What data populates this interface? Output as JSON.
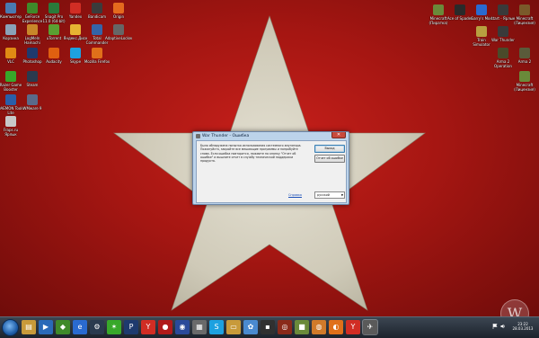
{
  "desktop_icons_left_row": [
    {
      "label": "Компьютер",
      "icon": "computer-icon",
      "color": "#4a7ab0"
    },
    {
      "label": "GeForce Experience",
      "icon": "nvidia-icon",
      "color": "#3f8a2a"
    },
    {
      "label": "Snagit Pro 11.0 (64-bit)",
      "icon": "snagit-icon",
      "color": "#2a7a3a"
    },
    {
      "label": "Yandex",
      "icon": "yandex-icon",
      "color": "#d12d24"
    },
    {
      "label": "Bandicam",
      "icon": "bandicam-icon",
      "color": "#3b3b3b"
    },
    {
      "label": "Origin",
      "icon": "origin-icon",
      "color": "#e46a1e"
    }
  ],
  "desktop_icons_left_row2": [
    {
      "label": "Корзина",
      "icon": "recycle-bin-icon",
      "color": "#8aa2b8"
    },
    {
      "label": "LogMeIn Hamachi",
      "icon": "hamachi-icon",
      "color": "#c8872a"
    },
    {
      "label": "uTorrent",
      "icon": "utorrent-icon",
      "color": "#5aa032"
    },
    {
      "label": "Яндекс.Диск",
      "icon": "yandex-disk-icon",
      "color": "#e6b332"
    },
    {
      "label": "Total Commander",
      "icon": "total-commander-icon",
      "color": "#3464a8"
    },
    {
      "label": "AdaptiveLocker",
      "icon": "locker-icon",
      "color": "#666666"
    }
  ],
  "desktop_icons_left_row3": [
    {
      "label": "Photoshop",
      "icon": "photoshop-icon",
      "color": "#1e3a6e"
    },
    {
      "label": "Audacity",
      "icon": "audacity-icon",
      "color": "#e06010"
    },
    {
      "label": "Skype",
      "icon": "skype-icon",
      "color": "#1da1e0"
    },
    {
      "label": "Mozilla Firefox",
      "icon": "firefox-icon",
      "color": "#e0701a"
    }
  ],
  "desktop_icons_left_col": [
    {
      "label": "VLC",
      "icon": "vlc-icon",
      "color": "#e08a14"
    },
    {
      "label": "Razer Game Booster",
      "icon": "razer-icon",
      "color": "#38a82a"
    },
    {
      "label": "Steam",
      "icon": "steam-icon",
      "color": "#2a3a4e"
    },
    {
      "label": "DAEMON Tools Lite",
      "icon": "daemon-tools-icon",
      "color": "#2a5ea8"
    },
    {
      "label": "WMware 9",
      "icon": "vmware-icon",
      "color": "#5a6a8a"
    },
    {
      "label": "Fraps.ru Ярлык",
      "icon": "fraps-icon",
      "color": "#c8c8c8"
    }
  ],
  "desktop_icons_right": [
    {
      "label": "Minecraft (Пиратка)",
      "icon": "minecraft-icon",
      "color": "#6a8a3a"
    },
    {
      "label": "Ace of Spades",
      "icon": "ace-of-spades-icon",
      "color": "#2a2a2a"
    },
    {
      "label": "Garry's Mod",
      "icon": "garrys-mod-icon",
      "color": "#2a6ad0"
    },
    {
      "label": "start - Ярлык",
      "icon": "start-shortcut-icon",
      "color": "#3a3a3a"
    },
    {
      "label": "Minecraft (Лицензия)",
      "icon": "minecraft-licensed-icon",
      "color": "#7a5a2a"
    },
    {
      "label": "Train Simulator",
      "icon": "train-simulator-icon",
      "color": "#b8a040"
    },
    {
      "label": "War Thunder",
      "icon": "war-thunder-icon",
      "color": "#3a3a3a"
    },
    {
      "label": "Arma 2",
      "icon": "arma2-icon",
      "color": "#5a5a3a"
    },
    {
      "label": "Arma 2 Operation",
      "icon": "arma2-oa-icon",
      "color": "#4a4a2a"
    },
    {
      "label": "Minecraft (Лицензия)",
      "icon": "minecraft-icon-2",
      "color": "#6a8a3a"
    }
  ],
  "dialog": {
    "title": "War Thunder - Ошибка",
    "close_label": "✕",
    "message": "Было обнаружена попытка использования системного эмулятора. Пожалуйста, закройте все мешающие программы и попробуйте снова. Если ошибка повторится, нажмите на кнопку \"Отчет об ошибке\" и вышлите отчет в службу технической поддержки продукта.",
    "exit_button": "Выход",
    "report_button": "Отчет об ошибке",
    "support_link": "Справка",
    "language_value": "русский"
  },
  "taskbar": {
    "clock_time": "23:22",
    "clock_date": "28.03.2013",
    "apps": [
      {
        "icon": "windows-explorer-icon",
        "glyph": "▤",
        "color": "#c89a3a"
      },
      {
        "icon": "media-player-icon",
        "glyph": "▶",
        "color": "#2a6ab8"
      },
      {
        "icon": "nvidia-icon",
        "glyph": "◆",
        "color": "#3f8a2a"
      },
      {
        "icon": "ie-icon",
        "glyph": "e",
        "color": "#2a6ad0"
      },
      {
        "icon": "steam-icon",
        "glyph": "⚙",
        "color": "#2a3a4e"
      },
      {
        "icon": "razer-icon",
        "glyph": "✶",
        "color": "#38a82a"
      },
      {
        "icon": "photoshop-icon",
        "glyph": "P",
        "color": "#1e3a6e"
      },
      {
        "icon": "yandex-icon",
        "glyph": "Y",
        "color": "#d12d24"
      },
      {
        "icon": "record-icon",
        "glyph": "●",
        "color": "#b01a1a"
      },
      {
        "icon": "uplay-icon",
        "glyph": "◉",
        "color": "#2a4a9a"
      },
      {
        "icon": "calculator-icon",
        "glyph": "▦",
        "color": "#6a6a6a"
      },
      {
        "icon": "skype-icon",
        "glyph": "S",
        "color": "#1da1e0"
      },
      {
        "icon": "folder-icon",
        "glyph": "▭",
        "color": "#c89a3a"
      },
      {
        "icon": "settings-icon",
        "glyph": "✿",
        "color": "#4a8ad0"
      },
      {
        "icon": "terminal-icon",
        "glyph": "▪",
        "color": "#303030"
      },
      {
        "icon": "dota-icon",
        "glyph": "◎",
        "color": "#8a2a1a"
      },
      {
        "icon": "minecraft-icon",
        "glyph": "■",
        "color": "#6a8a3a"
      },
      {
        "icon": "game-icon",
        "glyph": "◍",
        "color": "#d07a2a"
      },
      {
        "icon": "firefox-icon",
        "glyph": "◐",
        "color": "#e0701a"
      },
      {
        "icon": "yandex-browser-icon",
        "glyph": "Y",
        "color": "#d12d24"
      },
      {
        "icon": "war-thunder-icon",
        "glyph": "✈",
        "color": "#5a5a5a"
      }
    ]
  },
  "watermark": "W",
  "colors": {
    "background_red": "#a51612",
    "star": "#d9d5c6",
    "dialog_frame": "#bcd3ea"
  }
}
